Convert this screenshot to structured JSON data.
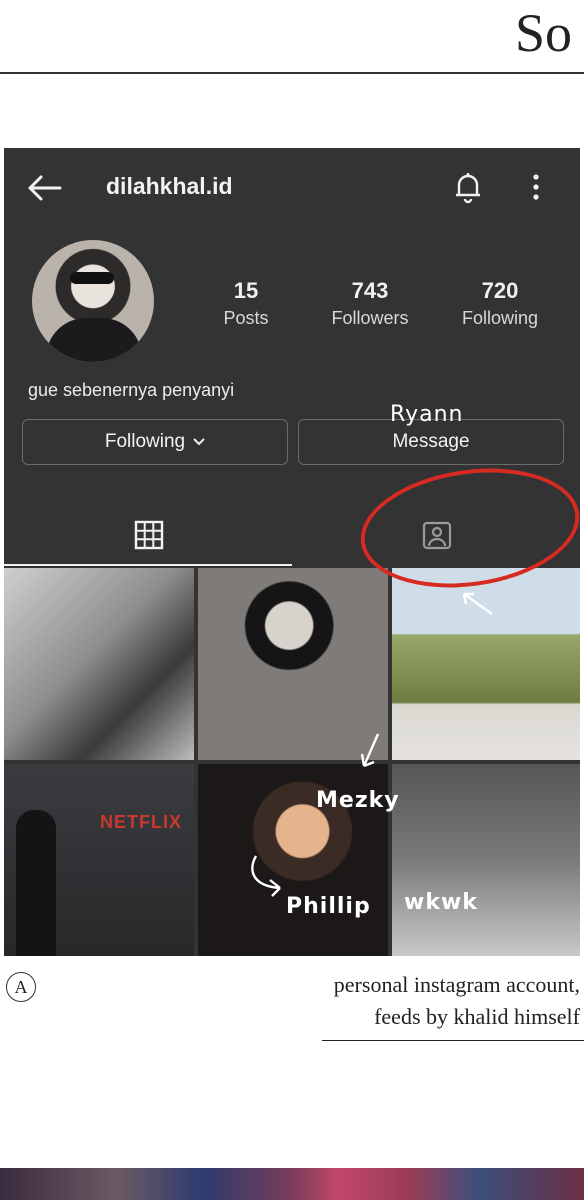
{
  "page": {
    "header_word": "So",
    "marker": "A",
    "caption_line1": "personal instagram account,",
    "caption_line2": "feeds by khalid himself"
  },
  "profile": {
    "username": "dilahkhal.id",
    "bio": "gue sebenernya penyanyi",
    "stats": [
      {
        "value": "15",
        "label": "Posts"
      },
      {
        "value": "743",
        "label": "Followers"
      },
      {
        "value": "720",
        "label": "Following"
      }
    ],
    "following_button": "Following",
    "message_button": "Message"
  },
  "grid": {
    "netflix_text": "NETFLIX"
  },
  "annotations": {
    "ryann": "Ryann",
    "mezky": "Mezky",
    "phillip": "Phillip",
    "wkwk": "wkwk"
  },
  "icons": [
    "back-arrow-icon",
    "bell-icon",
    "more-vertical-icon",
    "chevron-down-icon",
    "grid-icon",
    "tagged-icon"
  ],
  "colors": {
    "phone_bg": "#333334",
    "annotation_red": "#d62a23",
    "netflix_red": "#c8382e"
  }
}
